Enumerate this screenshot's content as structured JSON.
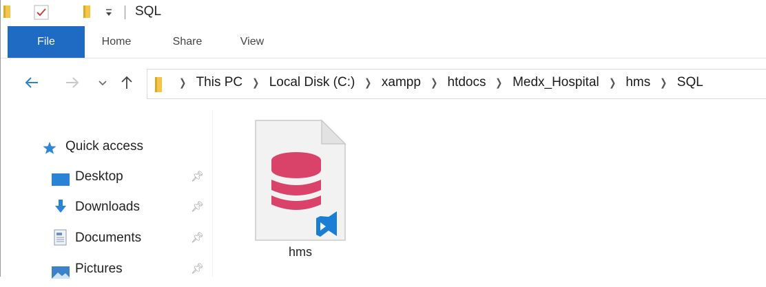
{
  "window": {
    "title": "SQL"
  },
  "ribbon": {
    "tabs": [
      {
        "label": "File"
      },
      {
        "label": "Home"
      },
      {
        "label": "Share"
      },
      {
        "label": "View"
      }
    ]
  },
  "address": {
    "crumbs": [
      "This PC",
      "Local Disk (C:)",
      "xampp",
      "htdocs",
      "Medx_Hospital",
      "hms",
      "SQL"
    ]
  },
  "sidebar": {
    "items": [
      {
        "label": "Quick access",
        "icon": "star-icon"
      },
      {
        "label": "Desktop",
        "icon": "desktop-icon",
        "pinned": true
      },
      {
        "label": "Downloads",
        "icon": "download-icon",
        "pinned": true
      },
      {
        "label": "Documents",
        "icon": "documents-icon",
        "pinned": true
      },
      {
        "label": "Pictures",
        "icon": "pictures-icon",
        "pinned": true
      }
    ]
  },
  "files": [
    {
      "name": "hms",
      "icon": "sql-database-file-icon"
    }
  ],
  "colors": {
    "accent": "#1f6bc4",
    "db_icon": "#d9436a",
    "vscode": "#1a7fd4",
    "folder": "#f3c64a"
  }
}
